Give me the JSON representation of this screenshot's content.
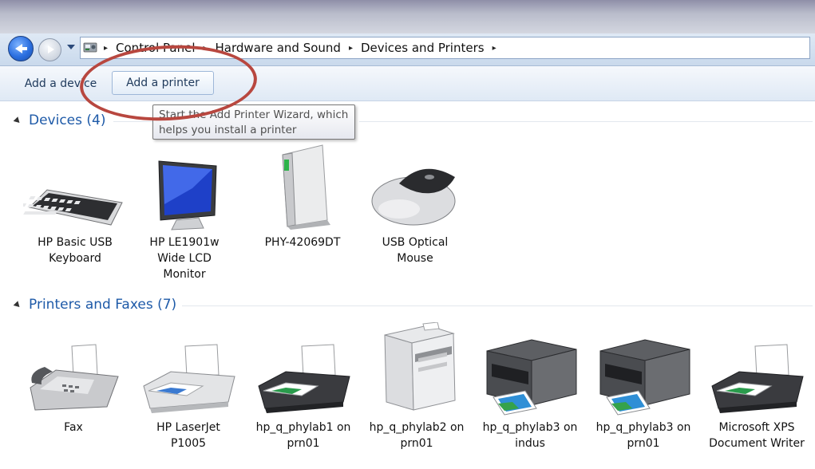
{
  "address_bar": {
    "breadcrumbs": [
      "Control Panel",
      "Hardware and Sound",
      "Devices and Printers"
    ],
    "separator": "▸"
  },
  "toolbar": {
    "add_device_label": "Add a device",
    "add_printer_label": "Add a printer"
  },
  "tooltip": {
    "line1": "Start the Add Printer Wizard, which",
    "line2": "helps you install a printer"
  },
  "groups": {
    "devices": {
      "header": "Devices (4)",
      "items": [
        {
          "label": [
            "HP Basic USB",
            "Keyboard"
          ],
          "icon": "keyboard-icon"
        },
        {
          "label": [
            "HP LE1901w",
            "Wide LCD",
            "Monitor"
          ],
          "icon": "monitor-icon"
        },
        {
          "label": [
            "PHY-42069DT"
          ],
          "icon": "computer-tower-icon"
        },
        {
          "label": [
            "USB Optical",
            "Mouse"
          ],
          "icon": "mouse-icon"
        }
      ]
    },
    "printers": {
      "header": "Printers and Faxes (7)",
      "items": [
        {
          "label": [
            "Fax"
          ],
          "icon": "fax-icon"
        },
        {
          "label": [
            "HP LaserJet",
            "P1005"
          ],
          "icon": "printer-icon"
        },
        {
          "label": [
            "hp_q_phylab1 on",
            "prn01"
          ],
          "icon": "printer-icon"
        },
        {
          "label": [
            "hp_q_phylab2 on",
            "prn01"
          ],
          "icon": "multifunction-printer-icon"
        },
        {
          "label": [
            "hp_q_phylab3 on",
            "indus"
          ],
          "icon": "photo-printer-icon"
        },
        {
          "label": [
            "hp_q_phylab3 on",
            "prn01"
          ],
          "icon": "photo-printer-icon"
        },
        {
          "label": [
            "Microsoft XPS",
            "Document Writer"
          ],
          "icon": "printer-icon"
        }
      ]
    }
  },
  "colors": {
    "annotation_circle": "#b8473f",
    "group_header": "#1e5aa8"
  }
}
